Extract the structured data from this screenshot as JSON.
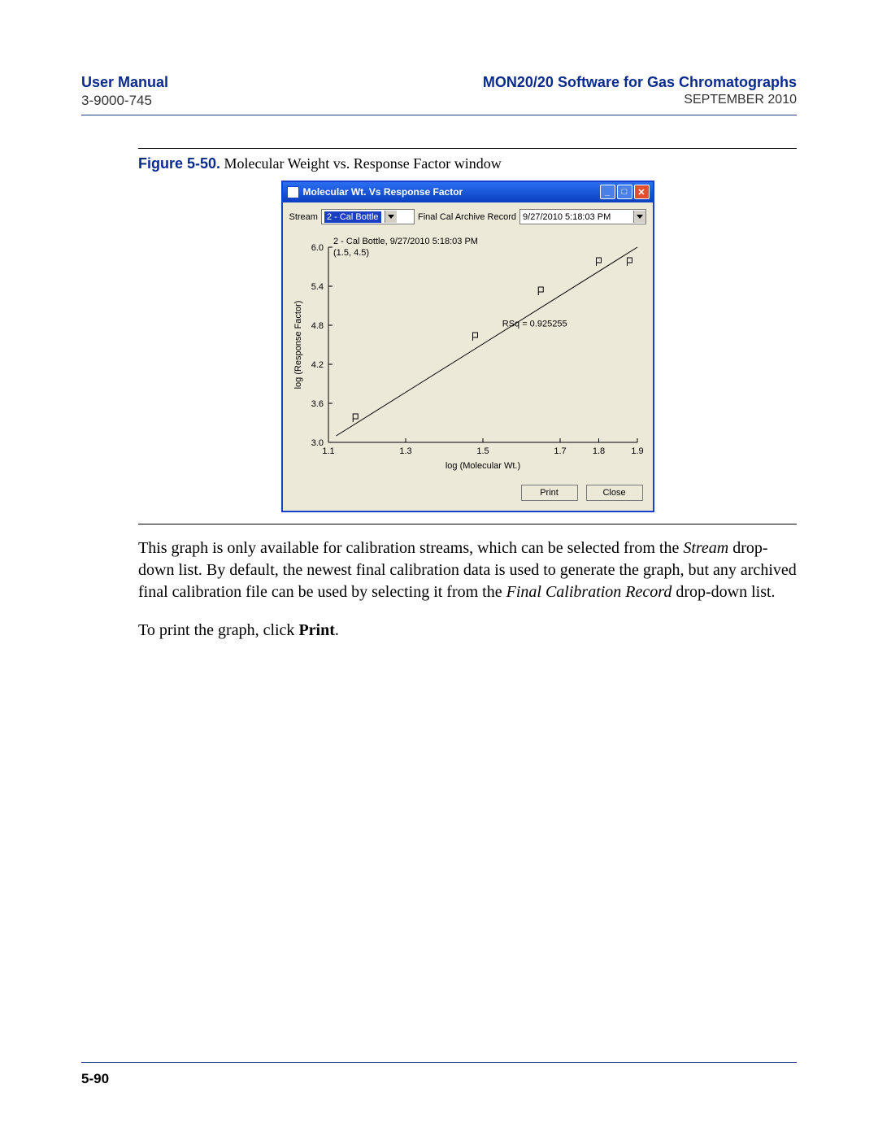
{
  "header": {
    "left_title": "User Manual",
    "left_sub": "3-9000-745",
    "right_title": "MON20/20 Software for Gas Chromatographs",
    "right_sub": "SEPTEMBER 2010"
  },
  "figure": {
    "label": "Figure 5-50.",
    "caption": "Molecular Weight vs. Response Factor window"
  },
  "window": {
    "title": "Molecular Wt. Vs Response Factor",
    "stream_label": "Stream",
    "stream_value": "2 - Cal Bottle",
    "record_label": "Final Cal Archive Record",
    "record_value": "9/27/2010 5:18:03 PM",
    "print_label": "Print",
    "close_label": "Close"
  },
  "chart_data": {
    "type": "scatter",
    "title": "2 - Cal Bottle, 9/27/2010 5:18:03 PM",
    "cursor_label": "(1.5, 4.5)",
    "xlabel": "log (Molecular Wt.)",
    "ylabel": "log (Response Factor)",
    "xlim": [
      1.1,
      1.9
    ],
    "ylim": [
      3.0,
      6.0
    ],
    "xticks": [
      1.1,
      1.3,
      1.5,
      1.7,
      1.8,
      1.9
    ],
    "yticks": [
      3.0,
      3.6,
      4.2,
      4.8,
      5.4,
      6.0
    ],
    "points": [
      {
        "x": 1.17,
        "y": 3.4
      },
      {
        "x": 1.48,
        "y": 4.65
      },
      {
        "x": 1.65,
        "y": 5.35
      },
      {
        "x": 1.8,
        "y": 5.8
      },
      {
        "x": 1.88,
        "y": 5.8
      }
    ],
    "fit_line": {
      "x1": 1.12,
      "y1": 3.1,
      "x2": 1.9,
      "y2": 6.0
    },
    "rsq_label": "RSq = 0.925255",
    "rsq_pos": {
      "x": 1.55,
      "y": 4.78
    }
  },
  "body": {
    "p1a": "This graph is only available for calibration streams, which can be selected from the ",
    "p1i1": "Stream",
    "p1b": " drop-down list.  By default, the newest final calibration data is used to generate the graph, but any archived final calibration file can be used by selecting it from the ",
    "p1i2": "Final Calibration Record",
    "p1c": " drop-down list.",
    "p2a": "To print the graph, click ",
    "p2b": "Print",
    "p2c": "."
  },
  "footer": {
    "page": "5-90"
  }
}
